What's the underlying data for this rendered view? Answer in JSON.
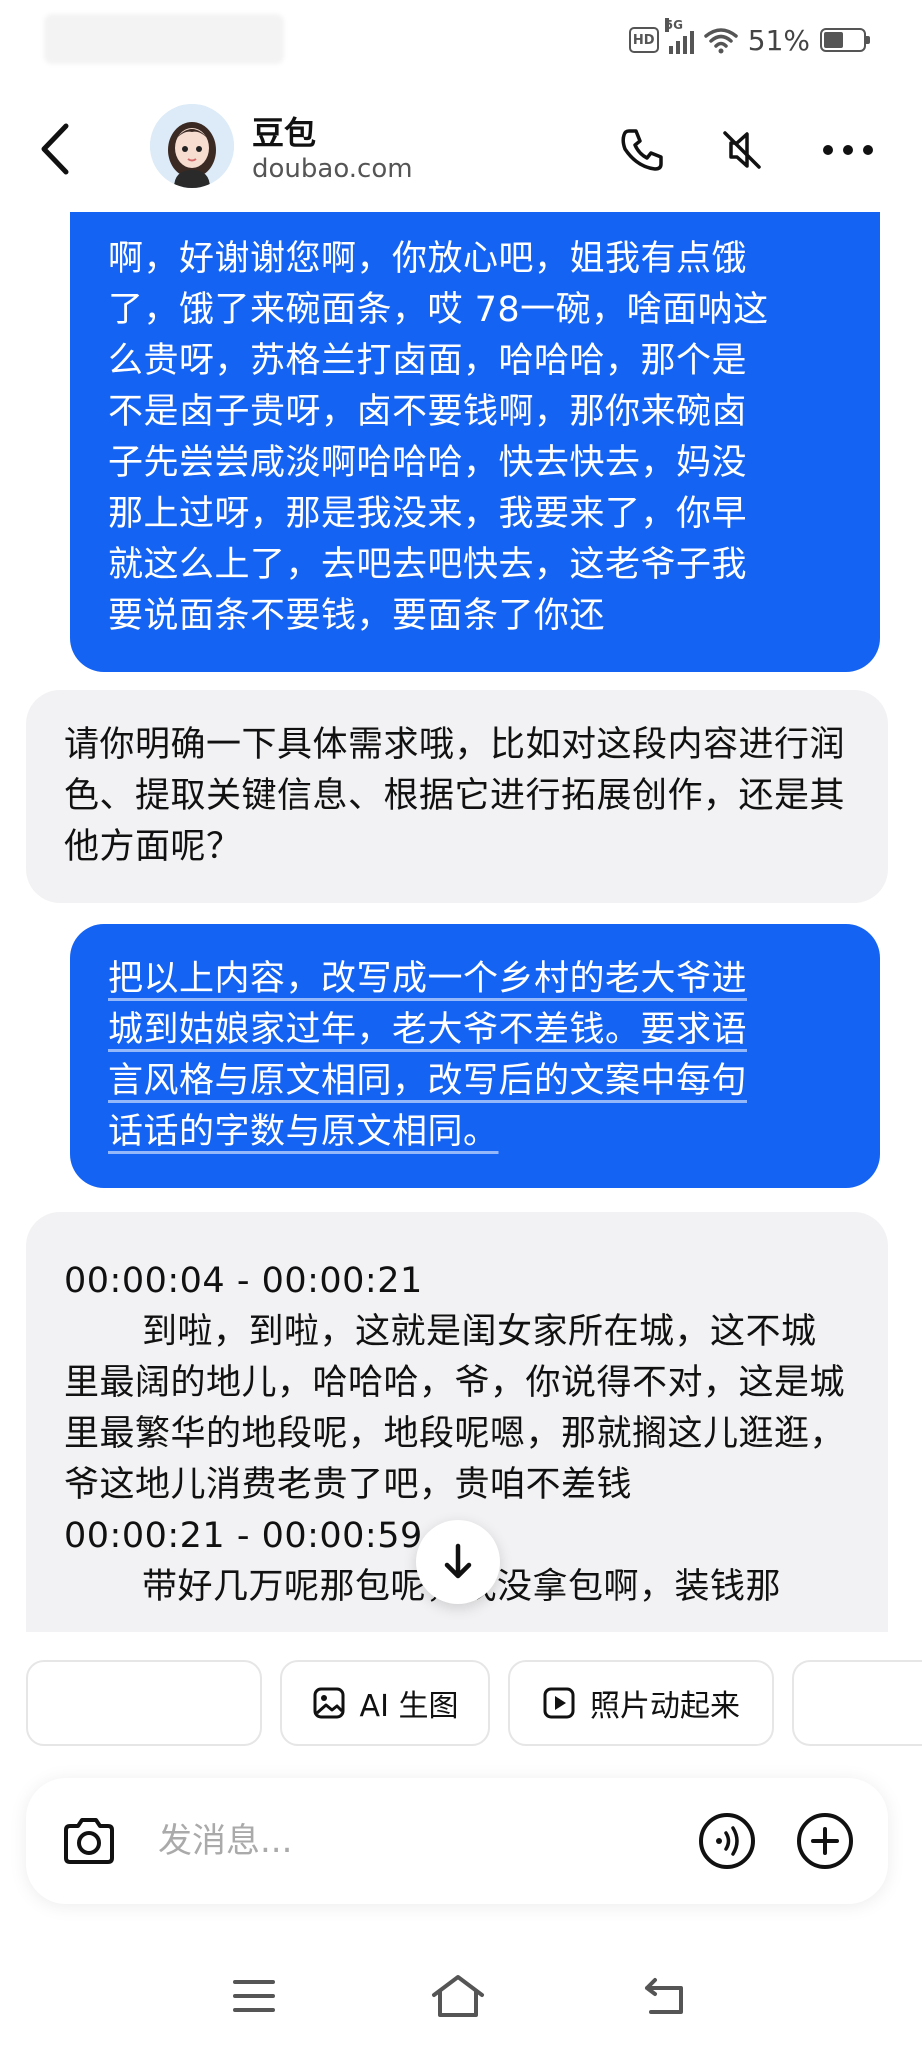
{
  "status_bar": {
    "hd_label": "HD",
    "network_label": "5G",
    "battery_percent": "51%",
    "battery_level": 0.51
  },
  "header": {
    "title": "豆包",
    "subtitle": "doubao.com"
  },
  "messages": [
    {
      "role": "user",
      "lines": [
        "啊，好谢谢您啊，你放心吧，姐我有点饿",
        "了，饿了来碗面条，哎 78一碗，啥面呐这",
        "么贵呀，苏格兰打卤面，哈哈哈，那个是",
        "不是卤子贵呀，卤不要钱啊，那你来碗卤",
        "子先尝尝咸淡啊哈哈哈，快去快去，妈没",
        "那上过呀，那是我没来，我要来了，你早",
        "就这么上了，去吧去吧快去，这老爷子我",
        "要说面条不要钱，要面条了你还"
      ]
    },
    {
      "role": "assistant",
      "text": "请你明确一下具体需求哦，比如对这段内容进行润色、提取关键信息、根据它进行拓展创作，还是其他方面呢？"
    },
    {
      "role": "user",
      "lines": [
        "把以上内容，改写成一个乡村的老大爷进",
        "城到姑娘家过年，老大爷不差钱。要求语",
        "言风格与原文相同，改写后的文案中每句",
        "话话的字数与原文相同。"
      ]
    },
    {
      "role": "assistant",
      "segments": [
        {
          "timestamp": "00:00:04 - 00:00:21",
          "text": "到啦，到啦，这就是闺女家所在城，这不城里最阔的地儿，哈哈哈，爷，你说得不对，这是城里最繁华的地段呢，地段呢嗯，那就搁这儿逛逛，爷这地儿消费老贵了吧，贵咱不差钱"
        },
        {
          "timestamp": "00:00:21 - 00:00:59",
          "text": "带好几万呢那包呢，我没拿包啊，装钱那"
        }
      ]
    }
  ],
  "suggestions": [
    {
      "label": ""
    },
    {
      "label": "AI 生图",
      "icon": "image-icon"
    },
    {
      "label": "照片动起来",
      "icon": "play-square-icon"
    },
    {
      "label": ""
    }
  ],
  "input": {
    "placeholder": "发消息..."
  }
}
